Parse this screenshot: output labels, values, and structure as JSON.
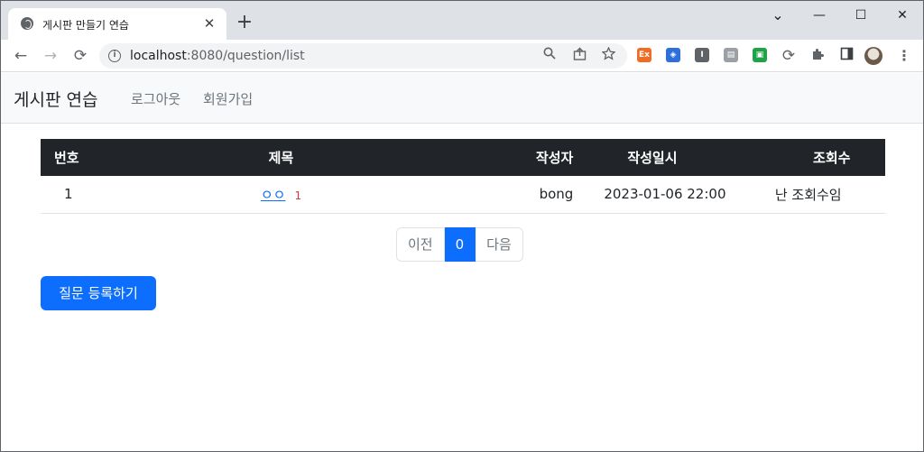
{
  "browser": {
    "tab_title": "게시판 만들기 연습",
    "tab_close": "✕",
    "new_tab": "+",
    "window_controls": {
      "dropdown": "⌄",
      "minimize": "—",
      "maximize": "☐",
      "close": "✕"
    },
    "nav": {
      "back": "←",
      "forward": "→",
      "reload": "⟳"
    },
    "url_host": "localhost",
    "url_rest": ":8080/question/list",
    "omnibox_icons": [
      "search-icon",
      "share-icon",
      "star-icon"
    ],
    "extensions": [
      {
        "name": "ext-orange-icon",
        "color": "#f26b22",
        "label": "Ex"
      },
      {
        "name": "ext-blue-icon",
        "color": "#2f6fdc",
        "label": "◈"
      },
      {
        "name": "ext-gray-icon",
        "color": "#5f6368",
        "label": "I"
      },
      {
        "name": "ext-window-icon",
        "color": "#9aa0a6",
        "label": "▤"
      },
      {
        "name": "ext-green-icon",
        "color": "#1ea446",
        "label": "▣"
      }
    ]
  },
  "navbar": {
    "brand": "게시판 연습",
    "links": [
      "로그아웃",
      "회원가입"
    ]
  },
  "table": {
    "headers": [
      "번호",
      "제목",
      "작성자",
      "작성일시",
      "조회수"
    ],
    "rows": [
      {
        "num": "1",
        "subject": "ㅇㅇ",
        "answer_count": "1",
        "author": "bong",
        "created": "2023-01-06 22:00",
        "views": "난 조회수임"
      }
    ]
  },
  "pagination": {
    "prev": "이전",
    "current": "0",
    "next": "다음"
  },
  "create_button": "질문 등록하기",
  "colors": {
    "primary": "#0d6efd",
    "dark": "#212529",
    "danger": "#dc3545",
    "navbar_bg": "#f8f9fa"
  }
}
